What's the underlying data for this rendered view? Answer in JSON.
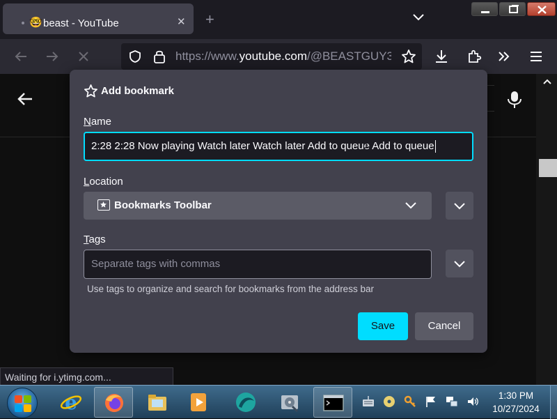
{
  "browser": {
    "tab": {
      "favicon": "🤓",
      "title": "beast - YouTube",
      "close_icon": "close-icon"
    },
    "new_tab_label": "+",
    "url": {
      "scheme": "https://www.",
      "host": "youtube.com",
      "path": "/@BEASTGUY3"
    },
    "status_text": "Waiting for i.ytimg.com..."
  },
  "dialog": {
    "title": "Add bookmark",
    "name": {
      "label_accel": "N",
      "label_rest": "ame",
      "value": "2:28 2:28 Now playing Watch later Watch later Add to queue Add to queue"
    },
    "location": {
      "label_accel": "L",
      "label_rest": "ocation",
      "value": "Bookmarks Toolbar"
    },
    "tags": {
      "label_accel": "T",
      "label_rest": "ags",
      "placeholder": "Separate tags with commas",
      "hint": "Use tags to organize and search for bookmarks from the address bar"
    },
    "save_label": "Save",
    "cancel_label": "Cancel"
  },
  "taskbar": {
    "time": "1:30 PM",
    "date": "10/27/2024",
    "apps": [
      "internet-explorer-icon",
      "firefox-icon",
      "file-explorer-icon",
      "media-player-icon",
      "app-icon",
      "disk-utility-icon",
      "command-prompt-icon"
    ]
  },
  "colors": {
    "accent": "#00ddff",
    "dialog_bg": "#42414d",
    "toolbar_bg": "#2b2a33",
    "taskbar": "#2d5472"
  }
}
